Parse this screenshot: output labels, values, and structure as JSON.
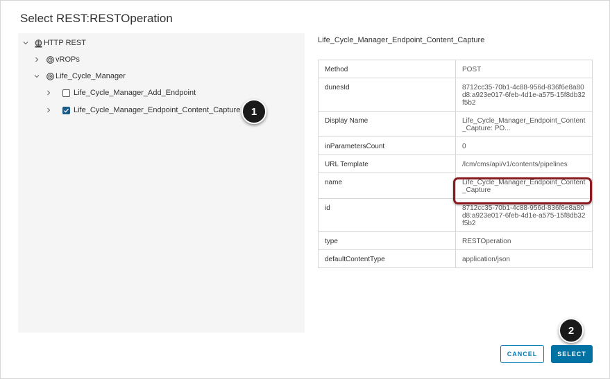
{
  "dialog": {
    "title": "Select REST:RESTOperation"
  },
  "tree": {
    "root": "HTTP REST",
    "items": [
      {
        "label": "vROPs"
      },
      {
        "label": "Life_Cycle_Manager"
      },
      {
        "label": "Life_Cycle_Manager_Add_Endpoint",
        "checked": false
      },
      {
        "label": "Life_Cycle_Manager_Endpoint_Content_Capture",
        "checked": true
      }
    ]
  },
  "detail": {
    "title": "Life_Cycle_Manager_Endpoint_Content_Capture",
    "rows": [
      {
        "key": "Method",
        "value": "POST"
      },
      {
        "key": "dunesId",
        "value": "8712cc35-70b1-4c88-956d-836f6e8a80d8:a923e017-6feb-4d1e-a575-15f8db32f5b2"
      },
      {
        "key": "Display Name",
        "value": "Life_Cycle_Manager_Endpoint_Content_Capture: PO..."
      },
      {
        "key": "inParametersCount",
        "value": "0"
      },
      {
        "key": "URL Template",
        "value": "/lcm/cms/api/v1/contents/pipelines"
      },
      {
        "key": "name",
        "value": "Life_Cycle_Manager_Endpoint_Content_Capture"
      },
      {
        "key": "id",
        "value": "8712cc35-70b1-4c88-956d-836f6e8a80d8:a923e017-6feb-4d1e-a575-15f8db32f5b2"
      },
      {
        "key": "type",
        "value": "RESTOperation"
      },
      {
        "key": "defaultContentType",
        "value": "application/json"
      }
    ]
  },
  "callouts": {
    "one": "1",
    "two": "2"
  },
  "buttons": {
    "cancel": "CANCEL",
    "select": "SELECT"
  },
  "colors": {
    "primary": "#0072a3",
    "highlight": "#8a1a1f",
    "tree_bg": "#f5f5f5"
  }
}
